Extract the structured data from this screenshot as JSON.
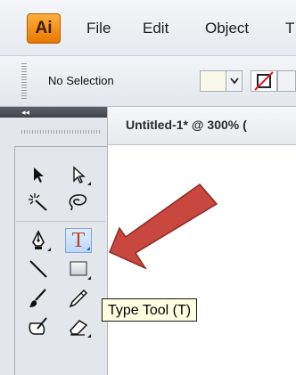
{
  "menubar": {
    "logo": "Ai",
    "items": [
      "File",
      "Edit",
      "Object",
      "T"
    ]
  },
  "controlbar": {
    "selection_label": "No Selection"
  },
  "document": {
    "tab_title": "Untitled-1* @ 300% ("
  },
  "tools": [
    {
      "name": "selection-tool",
      "icon": "arrow-icon"
    },
    {
      "name": "direct-selection-tool",
      "icon": "hollow-arrow-icon"
    },
    {
      "name": "magic-wand-tool",
      "icon": "magic-wand-icon"
    },
    {
      "name": "lasso-tool",
      "icon": "lasso-icon"
    },
    {
      "name": "pen-tool",
      "icon": "pen-nib-icon"
    },
    {
      "name": "type-tool",
      "icon": "type-icon",
      "glyph": "T",
      "active": true
    },
    {
      "name": "line-segment-tool",
      "icon": "line-icon"
    },
    {
      "name": "rectangle-tool",
      "icon": "rectangle-icon"
    },
    {
      "name": "paintbrush-tool",
      "icon": "paintbrush-icon"
    },
    {
      "name": "pencil-tool",
      "icon": "pencil-icon"
    },
    {
      "name": "blob-brush-tool",
      "icon": "blob-brush-icon"
    },
    {
      "name": "eraser-tool",
      "icon": "eraser-icon"
    }
  ],
  "tooltip": {
    "text": "Type Tool (T)"
  },
  "colors": {
    "arrow": "#c8473f",
    "type_tool": "#c0401f",
    "tooltip_bg": "#ffffe1",
    "logo": "#f28c0f"
  }
}
